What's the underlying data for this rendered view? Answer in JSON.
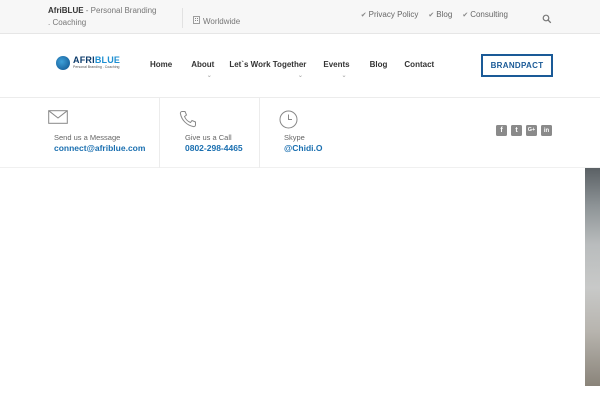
{
  "topbar": {
    "brand": "AfriBLUE",
    "tagline_rest": " - Personal Branding . Coaching",
    "location": "Worldwide",
    "links": [
      "Privacy Policy",
      "Blog",
      "Consulting"
    ]
  },
  "logo": {
    "part1": "AFRI",
    "part2": "BLUE",
    "sub": "Personal Branding . Coaching"
  },
  "nav": {
    "items": [
      "Home",
      "About",
      "Let`s Work Together",
      "Events",
      "Blog",
      "Contact"
    ],
    "cta": "BRANDPACT"
  },
  "contact": {
    "message": {
      "label": "Send us a Message",
      "value": "connect@afriblue.com"
    },
    "call": {
      "label": "Give us a Call",
      "value": "0802-298-4465"
    },
    "skype": {
      "label": "Skype",
      "value": "@Chidi.O"
    }
  },
  "social": [
    "f",
    "t",
    "G+",
    "in"
  ],
  "colors": {
    "accent": "#1a6fb0",
    "cta_border": "#1a5a97",
    "topbar_bg": "#f7f7f7"
  }
}
